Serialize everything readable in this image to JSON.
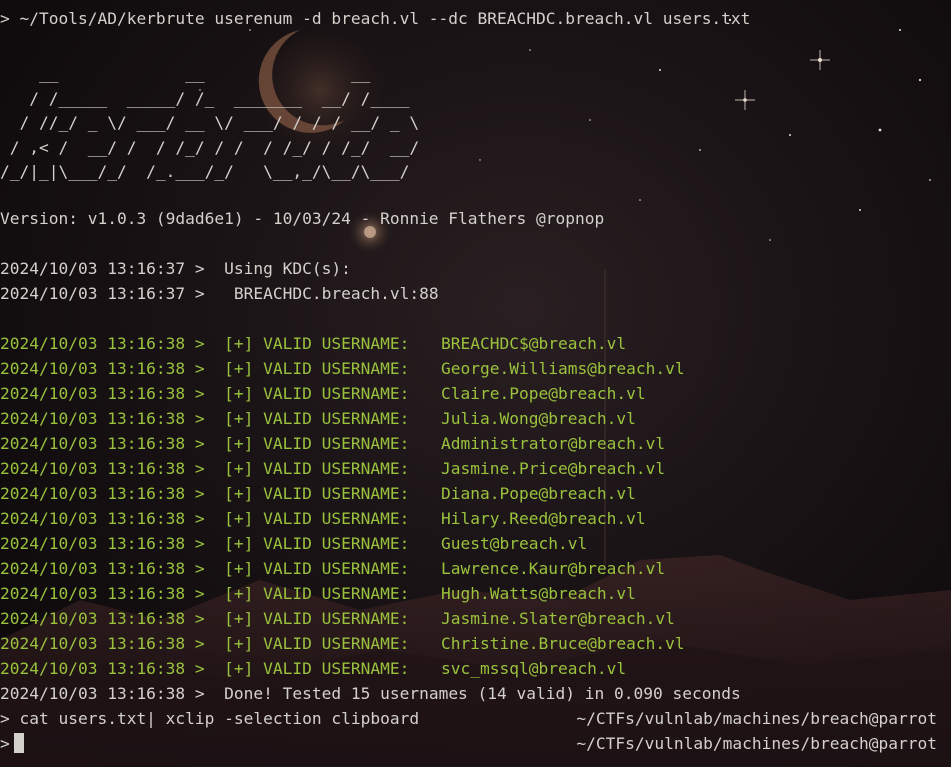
{
  "command": "> ~/Tools/AD/kerbrute userenum -d breach.vl --dc BREACHDC.breach.vl users.txt",
  "ascii_art": [
    "    __             __               __",
    "   / /_____  _____/ /_  _______  __/ /____",
    "  / //_/ _ \\/ ___/ __ \\/ ___/ / / / __/ _ \\",
    " / ,< /  __/ /  / /_/ / /  / /_/ / /_/  __/",
    "/_/|_|\\___/_/  /_.___/_/   \\__,_/\\__/\\___/"
  ],
  "version_line": "Version: v1.0.3 (9dad6e1) - 10/03/24 - Ronnie Flathers @ropnop",
  "kdc": {
    "line1_ts": "2024/10/03 13:16:37 >",
    "line1_msg": "  Using KDC(s):",
    "line2_ts": "2024/10/03 13:16:37 >",
    "line2_msg": "   BREACHDC.breach.vl:88"
  },
  "results": {
    "timestamp": "2024/10/03 13:16:38 >",
    "label": "  [+] VALID USERNAME:",
    "users": [
      "BREACHDC$@breach.vl",
      "George.Williams@breach.vl",
      "Claire.Pope@breach.vl",
      "Julia.Wong@breach.vl",
      "Administrator@breach.vl",
      "Jasmine.Price@breach.vl",
      "Diana.Pope@breach.vl",
      "Hilary.Reed@breach.vl",
      "Guest@breach.vl",
      "Lawrence.Kaur@breach.vl",
      "Hugh.Watts@breach.vl",
      "Jasmine.Slater@breach.vl",
      "Christine.Bruce@breach.vl",
      "svc_mssql@breach.vl"
    ]
  },
  "done": {
    "ts": "2024/10/03 13:16:38 >",
    "msg": "  Done! Tested 15 usernames (14 valid) in 0.090 seconds"
  },
  "cmd2": "> cat users.txt| xclip -selection clipboard",
  "cmd2_path": "~/CTFs/vulnlab/machines/breach@parrot",
  "prompt3": ">",
  "prompt3_path": "~/CTFs/vulnlab/machines/breach@parrot",
  "colors": {
    "text": "#d4d0cb",
    "valid_green": "#9ac23d",
    "background": "#140e10"
  }
}
